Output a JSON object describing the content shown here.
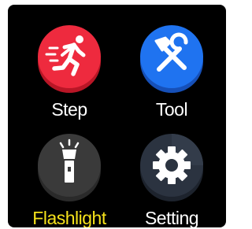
{
  "apps": [
    {
      "id": "step",
      "label": "Step",
      "icon": "running-person-icon",
      "color": "#ee2a3e",
      "shadow": "#b91626",
      "label_color": "#ffffff",
      "selected": false
    },
    {
      "id": "tool",
      "label": "Tool",
      "icon": "wrench-hammer-icon",
      "color": "#1f73f0",
      "shadow": "#1650b8",
      "label_color": "#ffffff",
      "selected": false
    },
    {
      "id": "flashlight",
      "label": "Flashlight",
      "icon": "flashlight-icon",
      "color": "#3a3a3a",
      "shadow": "#2a2a2a",
      "label_color": "#f6e21b",
      "selected": true
    },
    {
      "id": "setting",
      "label": "Setting",
      "icon": "gear-icon",
      "color": "#2b3340",
      "shadow": "#1d232d",
      "label_color": "#ffffff",
      "selected": false
    }
  ]
}
